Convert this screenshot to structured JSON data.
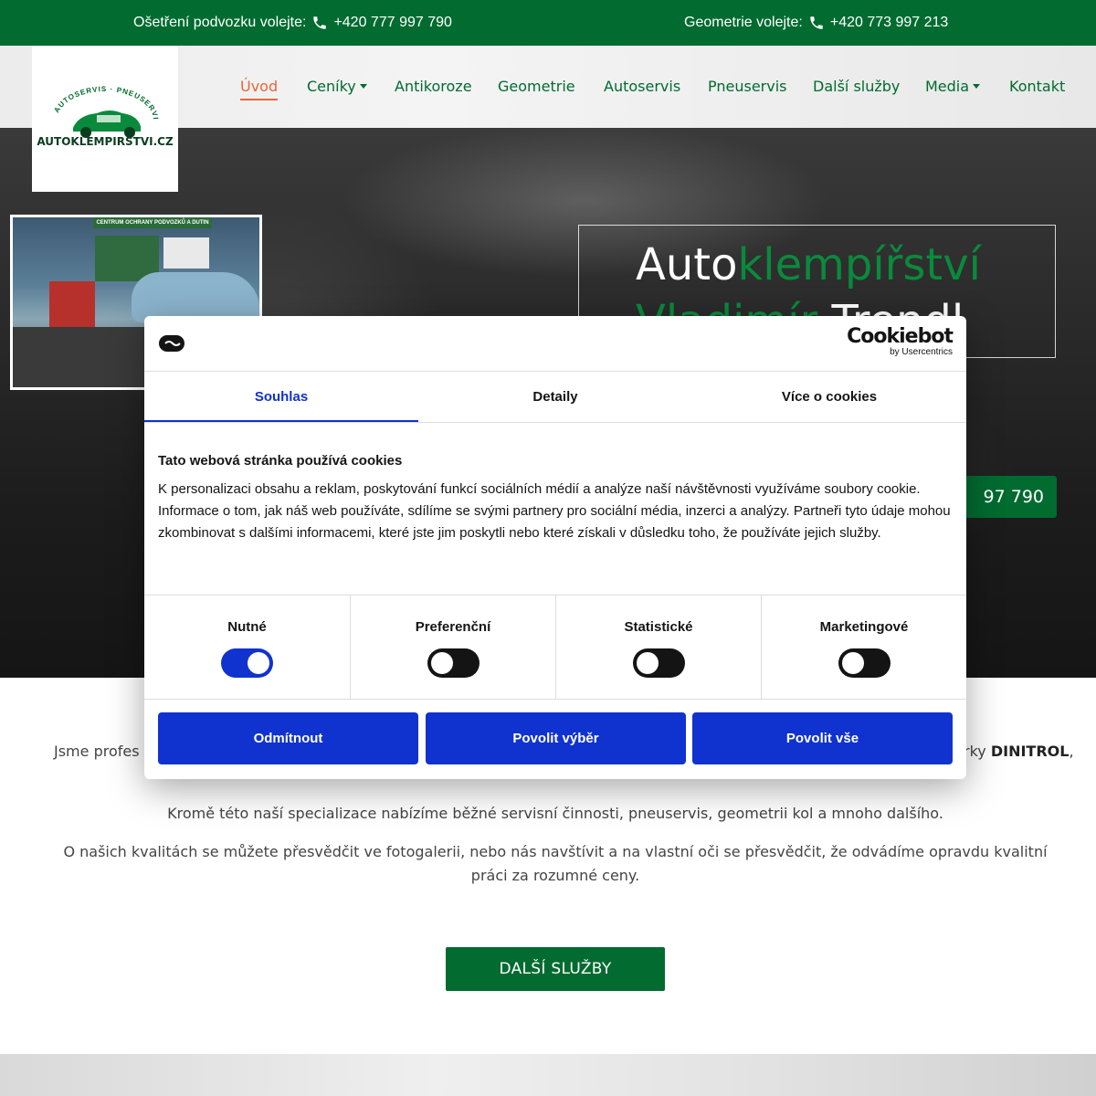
{
  "topbar": {
    "left_label": "Ošetření podvozku volejte:",
    "left_phone": "+420 777 997 790",
    "right_label": "Geometrie volejte:",
    "right_phone": "+420 773 997 213"
  },
  "logo": {
    "arc_text": "AUTOSERVIS · PNEUSERVIS",
    "domain": "AUTOKLEMPIRSTVI.CZ"
  },
  "nav": {
    "items": [
      {
        "label": "Úvod",
        "active": true
      },
      {
        "label": "Ceníky",
        "dropdown": true
      },
      {
        "label": "Antikoroze"
      },
      {
        "label": "Geometrie"
      },
      {
        "label": "Autoservis"
      },
      {
        "label": "Pneuservis"
      },
      {
        "label": "Další služby"
      },
      {
        "label": "Media",
        "dropdown": true
      },
      {
        "label": "Kontakt"
      }
    ]
  },
  "hero": {
    "title_part1": "Auto",
    "title_part2": "klempířství",
    "title_part3": "Vladimír",
    "title_part4": "Trendl",
    "phone_button": "97 790",
    "photo_sign": "CENTRUM OCHRANY PODVOZKŮ A DUTIN"
  },
  "content": {
    "p1_start": "Jsme profes",
    "p1_end_bold": "DINITROL",
    "p1_end": ",",
    "p1_fragment": "rky",
    "p2": "Kromě této naší specializace nabízíme běžné servisní činnosti, pneuservis, geometrii kol a mnoho dalšího.",
    "p3_line1": "O našich kvalitách se můžete přesvědčit ve fotogalerii, nebo nás navštívit a na vlastní oči se přesvědčit, že odvádíme opravdu kvalitní",
    "p3_line2": "práci za rozumné ceny.",
    "more_button": "DALŠÍ SLUŽBY"
  },
  "cookie": {
    "brand": "Cookiebot",
    "brand_sub": "by Usercentrics",
    "tabs": [
      "Souhlas",
      "Detaily",
      "Více o cookies"
    ],
    "title": "Tato webová stránka používá cookies",
    "text": "K personalizaci obsahu a reklam, poskytování funkcí sociálních médií a analýze naší návštěvnosti využíváme soubory cookie. Informace o tom, jak náš web používáte, sdílíme se svými partnery pro sociální média, inzerci a analýzy. Partneři tyto údaje mohou zkombinovat s dalšími informacemi, které jste jim poskytli nebo které získali v důsledku toho, že používáte jejich služby.",
    "categories": [
      {
        "label": "Nutné",
        "on": true
      },
      {
        "label": "Preferenční",
        "on": false
      },
      {
        "label": "Statistické",
        "on": false
      },
      {
        "label": "Marketingové",
        "on": false
      }
    ],
    "buttons": [
      "Odmítnout",
      "Povolit výběr",
      "Povolit vše"
    ]
  },
  "colors": {
    "brand_green": "#016b30",
    "accent_orange": "#e8663a",
    "cookie_blue": "#1032cf"
  }
}
